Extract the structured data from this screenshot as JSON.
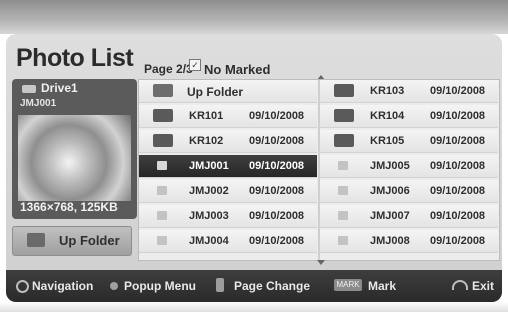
{
  "header": {
    "title": "Photo List",
    "page_info": "Page 2/3",
    "marked_label": "No Marked"
  },
  "preview": {
    "drive_label": "Drive1",
    "file_label": "JMJ001",
    "resolution": "1366×768, 125KB",
    "up_folder_label": "Up Folder"
  },
  "left_column": [
    {
      "icon": "folder-icon",
      "name": "Up Folder",
      "date": ""
    },
    {
      "icon": "folder-icon",
      "name": "KR101",
      "date": "09/10/2008"
    },
    {
      "icon": "folder-icon",
      "name": "KR102",
      "date": "09/10/2008"
    },
    {
      "icon": "file-icon",
      "name": "JMJ001",
      "date": "09/10/2008"
    },
    {
      "icon": "file-icon",
      "name": "JMJ002",
      "date": "09/10/2008"
    },
    {
      "icon": "file-icon",
      "name": "JMJ003",
      "date": "09/10/2008"
    },
    {
      "icon": "file-icon",
      "name": "JMJ004",
      "date": "09/10/2008"
    }
  ],
  "right_column": [
    {
      "icon": "folder-icon",
      "name": "KR103",
      "date": "09/10/2008"
    },
    {
      "icon": "folder-icon",
      "name": "KR104",
      "date": "09/10/2008"
    },
    {
      "icon": "folder-icon",
      "name": "KR105",
      "date": "09/10/2008"
    },
    {
      "icon": "file-icon",
      "name": "JMJ005",
      "date": "09/10/2008"
    },
    {
      "icon": "file-icon",
      "name": "JMJ006",
      "date": "09/10/2008"
    },
    {
      "icon": "file-icon",
      "name": "JMJ007",
      "date": "09/10/2008"
    },
    {
      "icon": "file-icon",
      "name": "JMJ008",
      "date": "09/10/2008"
    }
  ],
  "footer": {
    "navigation": "Navigation",
    "popup_menu": "Popup Menu",
    "page_change": "Page Change",
    "mark_box": "MARK",
    "mark": "Mark",
    "exit": "Exit"
  },
  "colors": {
    "panel": "#d6d6d6",
    "selected_row": "#2f2f2f",
    "footer_bar": "#333333"
  }
}
